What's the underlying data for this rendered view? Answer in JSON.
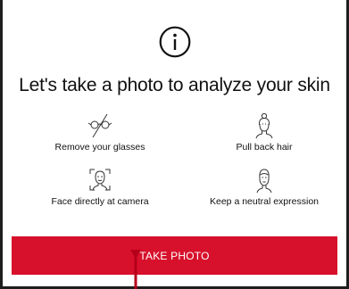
{
  "dialog": {
    "icon": "info-icon",
    "headline": "Let's take a photo to analyze your skin"
  },
  "instructions": [
    {
      "icon": "glasses-off-icon",
      "label": "Remove your glasses"
    },
    {
      "icon": "pulled-back-hair-icon",
      "label": "Pull back hair"
    },
    {
      "icon": "face-camera-frame-icon",
      "label": "Face directly at camera"
    },
    {
      "icon": "neutral-face-icon",
      "label": "Keep a neutral expression"
    }
  ],
  "actions": {
    "take_photo_label": "TAKE PHOTO"
  },
  "colors": {
    "button_red": "#d7102b",
    "pointer_red": "#b4001a",
    "text": "#111111",
    "background": "#ffffff"
  }
}
